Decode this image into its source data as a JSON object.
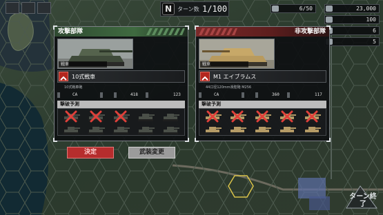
{
  "hud": {
    "left_buttons": [
      "",
      "",
      ""
    ],
    "turn_label": "ターン数",
    "turn_value": "1/100",
    "resources": [
      {
        "name": "fuel",
        "value": "6/50"
      },
      {
        "name": "funds",
        "value": "23,000"
      },
      {
        "name": "units",
        "value": "100"
      },
      {
        "name": "supply",
        "value": "6"
      },
      {
        "name": "extra",
        "value": "5"
      }
    ]
  },
  "attacker": {
    "header": "攻撃部隊",
    "unit_type": "戦車",
    "unit_name": "10式戦車",
    "weapon_tag": "",
    "weapon_name": "10式戦車砲",
    "stat_keys": [
      "",
      "",
      "",
      ""
    ],
    "stat_values": [
      "CA",
      "418",
      "123"
    ],
    "loss_label": "撃破予測",
    "losses": [
      true,
      true,
      true,
      false,
      false,
      false,
      false,
      false,
      false,
      false
    ]
  },
  "defender": {
    "header": "非攻撃部隊",
    "unit_type": "戦車",
    "unit_name": "M1 エイブラムス",
    "weapon_tag": "",
    "weapon_name": "44口径120mm滑腔砲 M256",
    "stat_keys": [
      "",
      "",
      "",
      ""
    ],
    "stat_values": [
      "CA",
      "360",
      "117"
    ],
    "loss_label": "撃破予測",
    "losses": [
      true,
      true,
      true,
      true,
      true,
      false,
      false,
      false,
      false,
      false
    ]
  },
  "buttons": {
    "confirm": "決定",
    "change_weapon": "武装変更"
  },
  "end_turn": "ターン終了",
  "colors": {
    "attacker_header": "#3f6a40",
    "defender_header": "#7a2a2a",
    "destroyed_x": "#e0403a",
    "confirm_button": "#b62d2d"
  }
}
